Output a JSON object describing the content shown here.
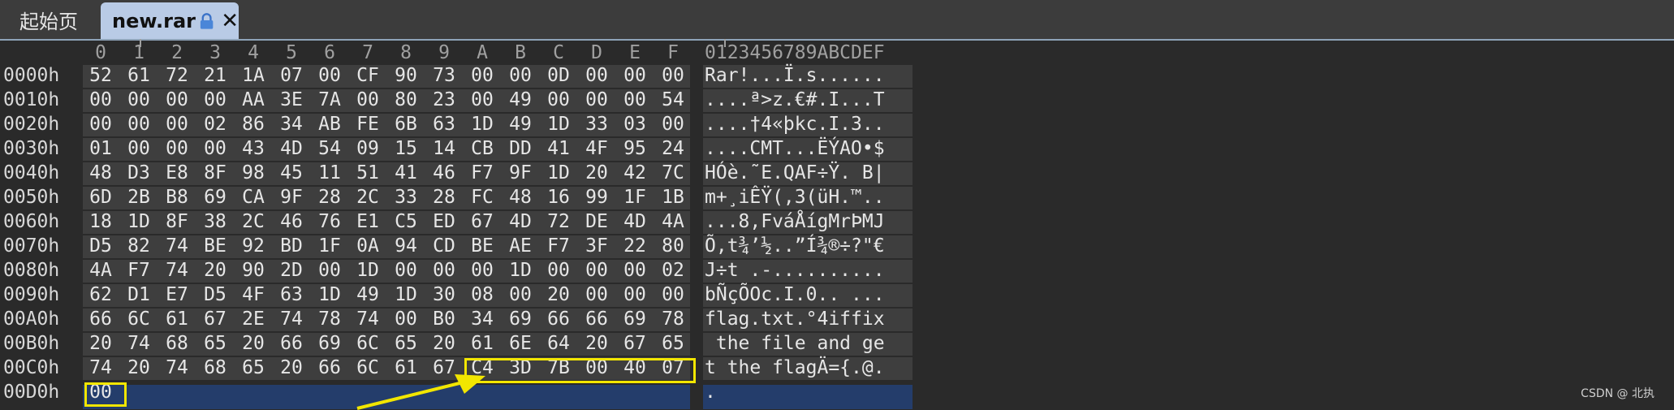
{
  "tabs": [
    {
      "label": "起始页"
    },
    {
      "label": "new.rar"
    }
  ],
  "columns": [
    "0",
    "1",
    "2",
    "3",
    "4",
    "5",
    "6",
    "7",
    "8",
    "9",
    "A",
    "B",
    "C",
    "D",
    "E",
    "F"
  ],
  "ascii_header": "0123456789ABCDEF",
  "rows": [
    {
      "offset": "0000h",
      "bytes": [
        "52",
        "61",
        "72",
        "21",
        "1A",
        "07",
        "00",
        "CF",
        "90",
        "73",
        "00",
        "00",
        "0D",
        "00",
        "00",
        "00"
      ],
      "ascii": "Rar!...Ï.s......"
    },
    {
      "offset": "0010h",
      "bytes": [
        "00",
        "00",
        "00",
        "00",
        "AA",
        "3E",
        "7A",
        "00",
        "80",
        "23",
        "00",
        "49",
        "00",
        "00",
        "00",
        "54"
      ],
      "ascii": "....ª>z.€#.I...T"
    },
    {
      "offset": "0020h",
      "bytes": [
        "00",
        "00",
        "00",
        "02",
        "86",
        "34",
        "AB",
        "FE",
        "6B",
        "63",
        "1D",
        "49",
        "1D",
        "33",
        "03",
        "00"
      ],
      "ascii": "....†4«þkc.I.3.."
    },
    {
      "offset": "0030h",
      "bytes": [
        "01",
        "00",
        "00",
        "00",
        "43",
        "4D",
        "54",
        "09",
        "15",
        "14",
        "CB",
        "DD",
        "41",
        "4F",
        "95",
        "24"
      ],
      "ascii": "....CMT...ËÝAO•$"
    },
    {
      "offset": "0040h",
      "bytes": [
        "48",
        "D3",
        "E8",
        "8F",
        "98",
        "45",
        "11",
        "51",
        "41",
        "46",
        "F7",
        "9F",
        "1D",
        "20",
        "42",
        "7C"
      ],
      "ascii": "HÓè.˜E.QAF÷Ÿ. B|"
    },
    {
      "offset": "0050h",
      "bytes": [
        "6D",
        "2B",
        "B8",
        "69",
        "CA",
        "9F",
        "28",
        "2C",
        "33",
        "28",
        "FC",
        "48",
        "16",
        "99",
        "1F",
        "1B"
      ],
      "ascii": "m+¸iÊŸ(,3(üH.™.."
    },
    {
      "offset": "0060h",
      "bytes": [
        "18",
        "1D",
        "8F",
        "38",
        "2C",
        "46",
        "76",
        "E1",
        "C5",
        "ED",
        "67",
        "4D",
        "72",
        "DE",
        "4D",
        "4A"
      ],
      "ascii": "...8,FváÅígMrÞMJ"
    },
    {
      "offset": "0070h",
      "bytes": [
        "D5",
        "82",
        "74",
        "BE",
        "92",
        "BD",
        "1F",
        "0A",
        "94",
        "CD",
        "BE",
        "AE",
        "F7",
        "3F",
        "22",
        "80"
      ],
      "ascii": "Õ‚t¾’½..”Í¾®÷?\"€"
    },
    {
      "offset": "0080h",
      "bytes": [
        "4A",
        "F7",
        "74",
        "20",
        "90",
        "2D",
        "00",
        "1D",
        "00",
        "00",
        "00",
        "1D",
        "00",
        "00",
        "00",
        "02"
      ],
      "ascii": "J÷t .-.........."
    },
    {
      "offset": "0090h",
      "bytes": [
        "62",
        "D1",
        "E7",
        "D5",
        "4F",
        "63",
        "1D",
        "49",
        "1D",
        "30",
        "08",
        "00",
        "20",
        "00",
        "00",
        "00"
      ],
      "ascii": "bÑçÕOc.I.0.. ..."
    },
    {
      "offset": "00A0h",
      "bytes": [
        "66",
        "6C",
        "61",
        "67",
        "2E",
        "74",
        "78",
        "74",
        "00",
        "B0",
        "34",
        "69",
        "66",
        "66",
        "69",
        "78"
      ],
      "ascii": "flag.txt.°4iffix"
    },
    {
      "offset": "00B0h",
      "bytes": [
        "20",
        "74",
        "68",
        "65",
        "20",
        "66",
        "69",
        "6C",
        "65",
        "20",
        "61",
        "6E",
        "64",
        "20",
        "67",
        "65"
      ],
      "ascii": " the file and ge"
    },
    {
      "offset": "00C0h",
      "bytes": [
        "74",
        "20",
        "74",
        "68",
        "65",
        "20",
        "66",
        "6C",
        "61",
        "67",
        "C4",
        "3D",
        "7B",
        "00",
        "40",
        "07"
      ],
      "ascii": "t the flagÄ={.@."
    },
    {
      "offset": "00D0h",
      "bytes": [
        "00"
      ],
      "ascii": "."
    }
  ],
  "watermark": "CSDN @ 北执",
  "colors": {
    "highlight_box": "#f2e600",
    "selection": "#243d6b",
    "active_tab": "#b9cbe6"
  }
}
